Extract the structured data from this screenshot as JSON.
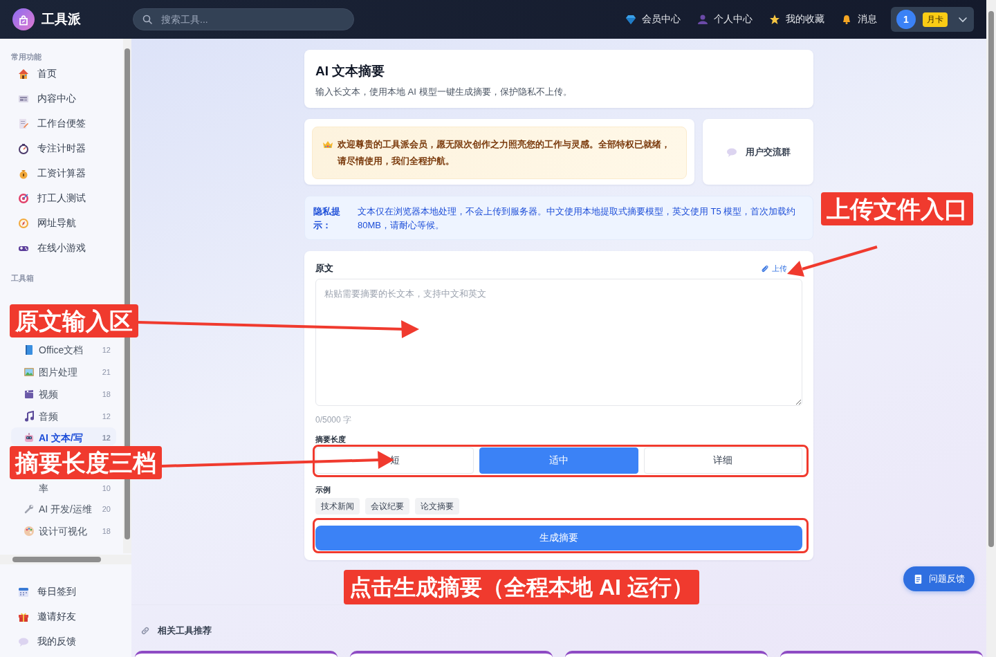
{
  "topbar": {
    "logo_text": "工具派",
    "search": {
      "placeholder": "搜索工具..."
    },
    "nav": [
      {
        "label": "会员中心"
      },
      {
        "label": "个人中心"
      },
      {
        "label": "我的收藏"
      },
      {
        "label": "消息"
      }
    ],
    "user": {
      "avatar": "1",
      "badge": "月卡"
    }
  },
  "sidebar": {
    "common_title": "常用功能",
    "common": [
      {
        "label": "首页"
      },
      {
        "label": "内容中心"
      },
      {
        "label": "工作台便签"
      },
      {
        "label": "专注计时器"
      },
      {
        "label": "工资计算器"
      },
      {
        "label": "打工人测试"
      },
      {
        "label": "网址导航"
      },
      {
        "label": "在线小游戏"
      }
    ],
    "tools_title": "工具箱",
    "tools": [
      {
        "label": "Office文档",
        "count": "12",
        "selected": false
      },
      {
        "label": "图片处理",
        "count": "21",
        "selected": false
      },
      {
        "label": "视频",
        "count": "18",
        "selected": false
      },
      {
        "label": "音频",
        "count": "12",
        "selected": false
      },
      {
        "label": "AI 文本/写",
        "count": "12",
        "selected": true
      },
      {
        "label": "率",
        "count": "10",
        "selected": false
      },
      {
        "label": "AI 开发/运维",
        "count": "20",
        "selected": false
      },
      {
        "label": "设计可视化",
        "count": "18",
        "selected": false
      }
    ],
    "bottom": [
      {
        "label": "每日签到"
      },
      {
        "label": "邀请好友"
      },
      {
        "label": "我的反馈"
      }
    ]
  },
  "page": {
    "title": "AI 文本摘要",
    "subtitle": "输入长文本，使用本地 AI 模型一键生成摘要，保护隐私不上传。",
    "welcome": "欢迎尊贵的工具派会员，愿无限次创作之力照亮您的工作与灵感。全部特权已就绪，请尽情使用，我们全程护航。",
    "group_button": "用户交流群",
    "privacy": {
      "label": "隐私提示：",
      "text": "文本仅在浏览器本地处理，不会上传到服务器。中文使用本地提取式摘要模型，英文使用 T5 模型，首次加载约 80MB，请耐心等候。"
    }
  },
  "form": {
    "source_label": "原文",
    "upload_link": "上传",
    "textarea": {
      "placeholder": "粘贴需要摘要的长文本，支持中文和英文"
    },
    "counter": "0/5000 字",
    "length_label": "摘要长度",
    "length_options": [
      {
        "label": "短",
        "selected": false
      },
      {
        "label": "适中",
        "selected": true
      },
      {
        "label": "详细",
        "selected": false
      }
    ],
    "examples_label": "示例",
    "examples": [
      "技术新闻",
      "会议纪要",
      "论文摘要"
    ],
    "submit": "生成摘要"
  },
  "feedback_button": "问题反馈",
  "related": {
    "title": "相关工具推荐"
  },
  "annotations": [
    "原文输入区",
    "摘要长度三档",
    "上传文件入口",
    "点击生成摘要（全程本地 AI 运行）"
  ]
}
